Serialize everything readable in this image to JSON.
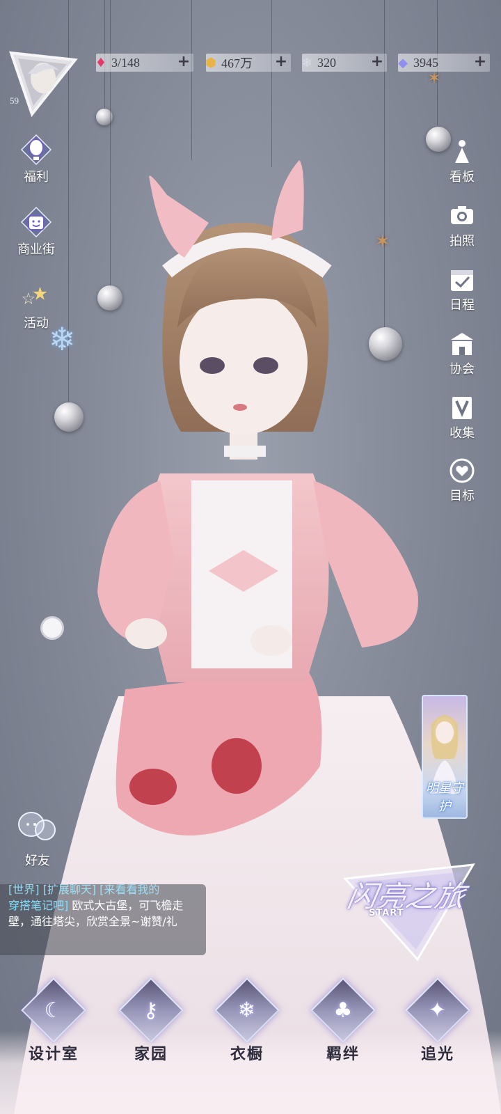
{
  "profile": {
    "level": "59",
    "avatar_icon": "avatar-portrait-icon"
  },
  "resources": [
    {
      "id": "stamina",
      "icon": "heart-gem-icon",
      "value": "3/148",
      "color": "#e23b6a"
    },
    {
      "id": "gold",
      "icon": "gold-coin-icon",
      "value": "467万",
      "color": "#e8b447"
    },
    {
      "id": "crystal",
      "icon": "snowflake-crystal-icon",
      "value": "320",
      "color": "#c9c9d6"
    },
    {
      "id": "diamond",
      "icon": "diamond-icon",
      "value": "3945",
      "color": "#8f8ff0"
    }
  ],
  "left_menu": [
    {
      "id": "welfare",
      "label": "福利",
      "icon": "hot-air-balloon-icon"
    },
    {
      "id": "shop",
      "label": "商业街",
      "icon": "shopping-bag-icon"
    },
    {
      "id": "events",
      "label": "活动",
      "icon": "stars-icon"
    }
  ],
  "right_menu": [
    {
      "id": "board",
      "label": "看板",
      "icon": "dress-figure-icon"
    },
    {
      "id": "photo",
      "label": "拍照",
      "icon": "camera-icon"
    },
    {
      "id": "schedule",
      "label": "日程",
      "icon": "calendar-check-icon"
    },
    {
      "id": "guild",
      "label": "协会",
      "icon": "building-icon"
    },
    {
      "id": "collection",
      "label": "收集",
      "icon": "v-book-icon"
    },
    {
      "id": "goals",
      "label": "目标",
      "icon": "heart-badge-icon"
    }
  ],
  "banner": {
    "title": "明星守护"
  },
  "start_badge": {
    "title": "闪亮之旅",
    "subtitle": "START"
  },
  "friends": {
    "label": "好友",
    "icon": "chat-bubble-icon"
  },
  "chat": {
    "cut_line": "[世界] [扩展聊天] [来看看我的",
    "highlight": "穿搭笔记吧]",
    "text": " 欧式大古堡，可飞檐走壁，通往塔尖，欣赏全景~谢赞/礼"
  },
  "bottom_nav": [
    {
      "id": "design",
      "label": "设计室",
      "icon": "crescent-moon-icon"
    },
    {
      "id": "home",
      "label": "家园",
      "icon": "key-icon"
    },
    {
      "id": "wardrobe",
      "label": "衣橱",
      "icon": "snowflake-icon"
    },
    {
      "id": "bonds",
      "label": "羁绊",
      "icon": "clover-icon"
    },
    {
      "id": "chase",
      "label": "追光",
      "icon": "butterfly-icon"
    }
  ]
}
